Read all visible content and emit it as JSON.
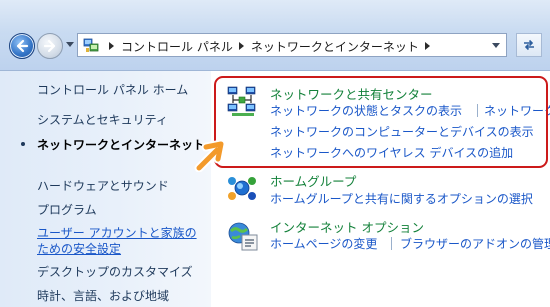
{
  "address_bar": {
    "breadcrumbs": [
      "コントロール パネル",
      "ネットワークとインターネット"
    ]
  },
  "left_nav": {
    "items": [
      {
        "label": "コントロール パネル ホーム",
        "state": "normal"
      },
      {
        "label": "システムとセキュリティ",
        "state": "normal"
      },
      {
        "label": "ネットワークとインターネット",
        "state": "current"
      },
      {
        "label": "ハードウェアとサウンド",
        "state": "normal"
      },
      {
        "label": "プログラム",
        "state": "normal"
      },
      {
        "label": "ユーザー アカウントと家族の",
        "state": "link"
      },
      {
        "label": "ための安全設定",
        "state": "link"
      },
      {
        "label": "デスクトップのカスタマイズ",
        "state": "normal"
      },
      {
        "label": "時計、言語、および地域",
        "state": "normal"
      }
    ]
  },
  "categories": [
    {
      "title": "ネットワークと共有センター",
      "icon": "network-sharing-center-icon",
      "tasks": [
        "ネットワークの状態とタスクの表示",
        "ネットワーク",
        "ネットワークのコンピューターとデバイスの表示",
        "ネットワークへのワイヤレス デバイスの追加"
      ]
    },
    {
      "title": "ホームグループ",
      "icon": "homegroup-icon",
      "tasks": [
        "ホームグループと共有に関するオプションの選択"
      ]
    },
    {
      "title": "インターネット オプション",
      "icon": "internet-options-icon",
      "tasks": [
        "ホームページの変更",
        "ブラウザーのアドオンの管理"
      ]
    }
  ],
  "colors": {
    "highlight_border": "#cc1a1a",
    "pointer_arrow": "#f39a2b",
    "category_title": "#13813a",
    "link": "#1a57c8"
  }
}
